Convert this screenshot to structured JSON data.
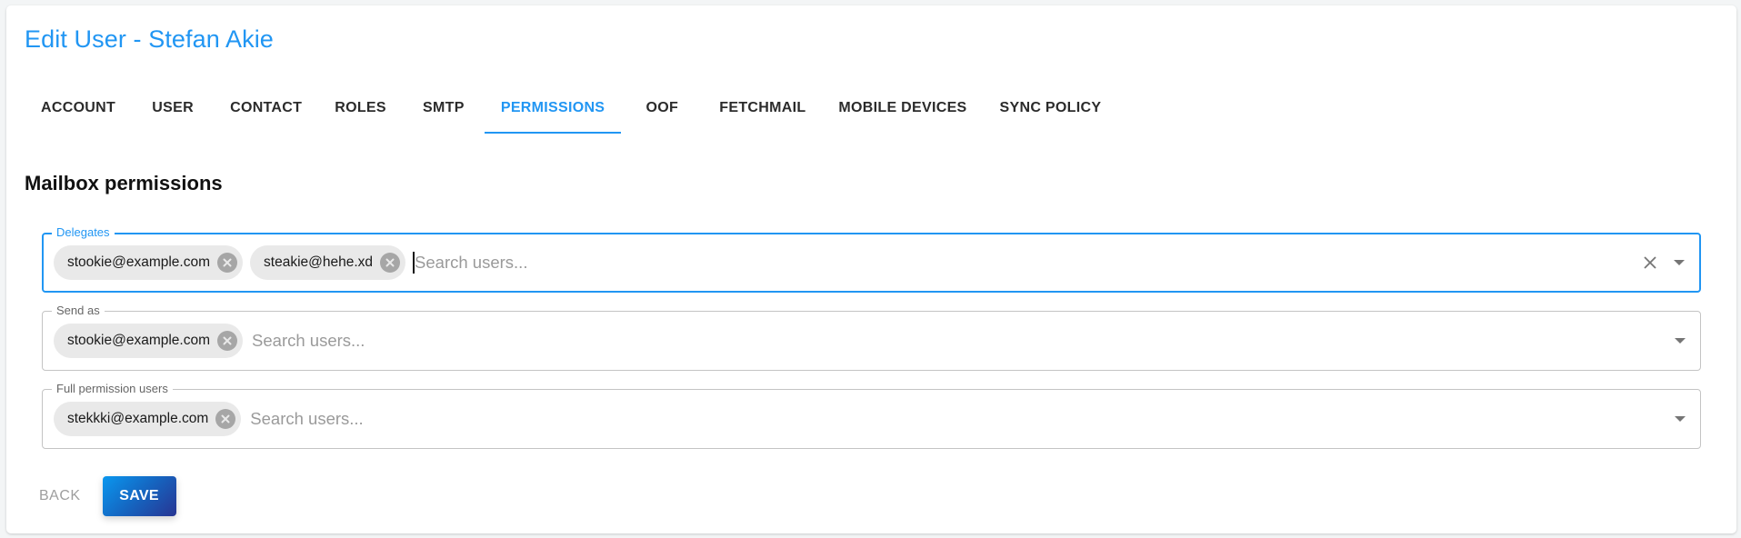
{
  "page": {
    "title": "Edit User - Stefan Akie"
  },
  "tabs": [
    {
      "label": "ACCOUNT",
      "active": false
    },
    {
      "label": "USER",
      "active": false
    },
    {
      "label": "CONTACT",
      "active": false
    },
    {
      "label": "ROLES",
      "active": false
    },
    {
      "label": "SMTP",
      "active": false
    },
    {
      "label": "PERMISSIONS",
      "active": true
    },
    {
      "label": "OOF",
      "active": false
    },
    {
      "label": "FETCHMAIL",
      "active": false
    },
    {
      "label": "MOBILE DEVICES",
      "active": false
    },
    {
      "label": "SYNC POLICY",
      "active": false
    }
  ],
  "section": {
    "title": "Mailbox permissions"
  },
  "fields": {
    "delegates": {
      "label": "Delegates",
      "chips": [
        "stookie@example.com",
        "steakie@hehe.xd"
      ],
      "placeholder": "Search users...",
      "value": "",
      "focused": true
    },
    "send_as": {
      "label": "Send as",
      "chips": [
        "stookie@example.com"
      ],
      "placeholder": "Search users...",
      "value": ""
    },
    "full_permission": {
      "label": "Full permission users",
      "chips": [
        "stekkki@example.com"
      ],
      "placeholder": "Search users...",
      "value": ""
    }
  },
  "icons": {
    "chip_remove": "cancel-circle-icon",
    "clear": "close-icon",
    "dropdown": "arrow-drop-down-icon"
  },
  "actions": {
    "back_label": "BACK",
    "save_label": "SAVE"
  },
  "colors": {
    "accent": "#2196f3",
    "save_gradient_start": "#0a97ef",
    "save_gradient_end": "#283593",
    "chip_bg": "#e9e9e9"
  }
}
